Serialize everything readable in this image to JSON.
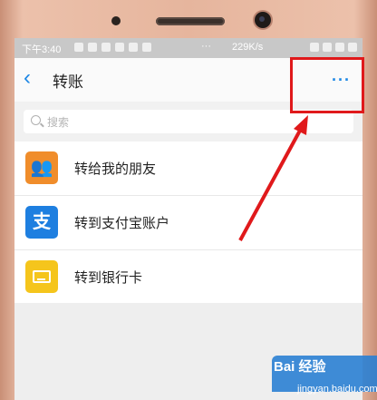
{
  "statusbar": {
    "time": "下午3:40",
    "dots": "···",
    "speed": "229K/s"
  },
  "header": {
    "back_icon": "chevron-left-icon",
    "title": "转账",
    "more_label": "···"
  },
  "search": {
    "placeholder": "搜索"
  },
  "menu": {
    "items": [
      {
        "label": "转给我的朋友",
        "icon": "friends-icon",
        "color": "#f08d2b"
      },
      {
        "label": "转到支付宝账户",
        "icon": "alipay-icon",
        "color": "#1e7fe0"
      },
      {
        "label": "转到银行卡",
        "icon": "bank-card-icon",
        "color": "#f5c51c"
      }
    ]
  },
  "annotation": {
    "highlight_color": "#e0191b"
  },
  "watermark": {
    "main": "Bai 经验",
    "sub": "jingyan.baidu.com"
  }
}
